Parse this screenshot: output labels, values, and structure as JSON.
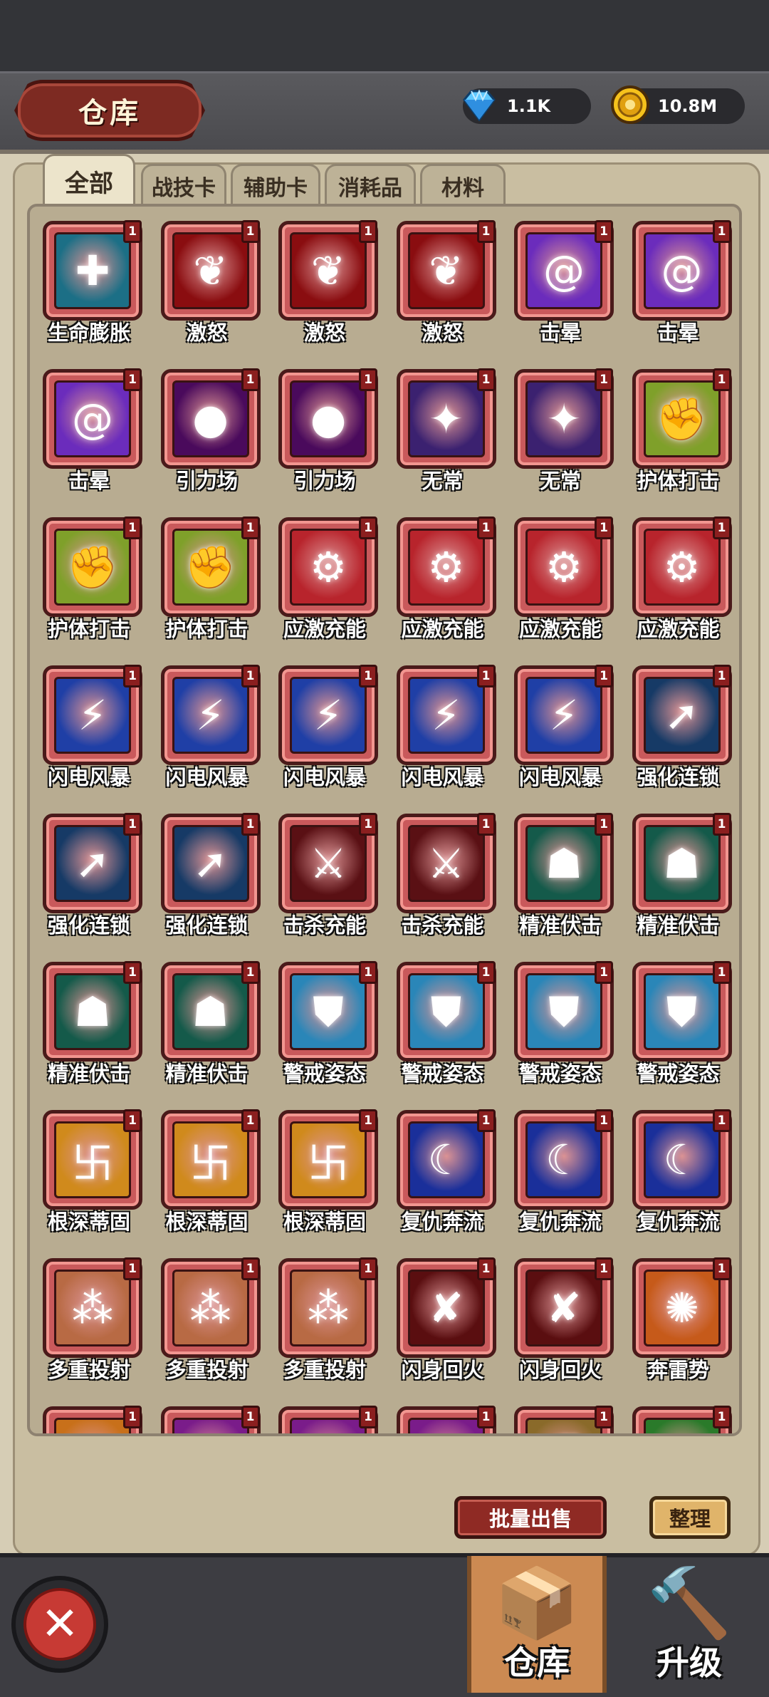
{
  "header": {
    "title": "仓库",
    "gems": "1.1K",
    "coins": "10.8M",
    "gem_icon": "diamond-icon",
    "coin_icon": "coin-icon"
  },
  "tabs": [
    {
      "label": "全部",
      "active": true
    },
    {
      "label": "战技卡"
    },
    {
      "label": "辅助卡"
    },
    {
      "label": "消耗品"
    },
    {
      "label": "材料"
    }
  ],
  "items": [
    {
      "name": "生命膨胀",
      "count": "1",
      "icon": "heal-icon",
      "color": "#1c6f86"
    },
    {
      "name": "激怒",
      "count": "1",
      "icon": "rage-icon",
      "color": "#8a0d10"
    },
    {
      "name": "激怒",
      "count": "1",
      "icon": "rage-icon",
      "color": "#8a0d10"
    },
    {
      "name": "激怒",
      "count": "1",
      "icon": "rage-icon",
      "color": "#8a0d10"
    },
    {
      "name": "击晕",
      "count": "1",
      "icon": "vortex-icon",
      "color": "#6b2cbc"
    },
    {
      "name": "击晕",
      "count": "1",
      "icon": "vortex-icon",
      "color": "#6b2cbc"
    },
    {
      "name": "击晕",
      "count": "1",
      "icon": "vortex-icon",
      "color": "#6b2cbc"
    },
    {
      "name": "引力场",
      "count": "1",
      "icon": "gravity-icon",
      "color": "#4a0a5c"
    },
    {
      "name": "引力场",
      "count": "1",
      "icon": "gravity-icon",
      "color": "#4a0a5c"
    },
    {
      "name": "无常",
      "count": "1",
      "icon": "eye-icon",
      "color": "#3b2170"
    },
    {
      "name": "无常",
      "count": "1",
      "icon": "eye-icon",
      "color": "#3b2170"
    },
    {
      "name": "护体打击",
      "count": "1",
      "icon": "fist-icon",
      "color": "#7fa02a"
    },
    {
      "name": "护体打击",
      "count": "1",
      "icon": "fist-icon",
      "color": "#7fa02a"
    },
    {
      "name": "护体打击",
      "count": "1",
      "icon": "fist-icon",
      "color": "#7fa02a"
    },
    {
      "name": "应激充能",
      "count": "1",
      "icon": "gear-icon",
      "color": "#b8242c"
    },
    {
      "name": "应激充能",
      "count": "1",
      "icon": "gear-icon",
      "color": "#b8242c"
    },
    {
      "name": "应激充能",
      "count": "1",
      "icon": "gear-icon",
      "color": "#b8242c"
    },
    {
      "name": "应激充能",
      "count": "1",
      "icon": "gear-icon",
      "color": "#b8242c"
    },
    {
      "name": "闪电风暴",
      "count": "1",
      "icon": "lightning-icon",
      "color": "#1f3fa6"
    },
    {
      "name": "闪电风暴",
      "count": "1",
      "icon": "lightning-icon",
      "color": "#1f3fa6"
    },
    {
      "name": "闪电风暴",
      "count": "1",
      "icon": "lightning-icon",
      "color": "#1f3fa6"
    },
    {
      "name": "闪电风暴",
      "count": "1",
      "icon": "lightning-icon",
      "color": "#1f3fa6"
    },
    {
      "name": "闪电风暴",
      "count": "1",
      "icon": "lightning-icon",
      "color": "#1f3fa6"
    },
    {
      "name": "强化连锁",
      "count": "1",
      "icon": "arrow-up-icon",
      "color": "#163a66"
    },
    {
      "name": "强化连锁",
      "count": "1",
      "icon": "arrow-up-icon",
      "color": "#163a66"
    },
    {
      "name": "强化连锁",
      "count": "1",
      "icon": "arrow-up-icon",
      "color": "#163a66"
    },
    {
      "name": "击杀充能",
      "count": "1",
      "icon": "blade-icon",
      "color": "#5a1014"
    },
    {
      "name": "击杀充能",
      "count": "1",
      "icon": "blade-icon",
      "color": "#5a1014"
    },
    {
      "name": "精准伏击",
      "count": "1",
      "icon": "shadow-icon",
      "color": "#145a4a"
    },
    {
      "name": "精准伏击",
      "count": "1",
      "icon": "shadow-icon",
      "color": "#145a4a"
    },
    {
      "name": "精准伏击",
      "count": "1",
      "icon": "shadow-icon",
      "color": "#145a4a"
    },
    {
      "name": "精准伏击",
      "count": "1",
      "icon": "shadow-icon",
      "color": "#145a4a"
    },
    {
      "name": "警戒姿态",
      "count": "1",
      "icon": "shield-icon",
      "color": "#2a86b8"
    },
    {
      "name": "警戒姿态",
      "count": "1",
      "icon": "shield-icon",
      "color": "#2a86b8"
    },
    {
      "name": "警戒姿态",
      "count": "1",
      "icon": "shield-icon",
      "color": "#2a86b8"
    },
    {
      "name": "警戒姿态",
      "count": "1",
      "icon": "shield-icon",
      "color": "#2a86b8"
    },
    {
      "name": "根深蒂固",
      "count": "1",
      "icon": "root-icon",
      "color": "#d08a1c"
    },
    {
      "name": "根深蒂固",
      "count": "1",
      "icon": "root-icon",
      "color": "#d08a1c"
    },
    {
      "name": "根深蒂固",
      "count": "1",
      "icon": "root-icon",
      "color": "#d08a1c"
    },
    {
      "name": "复仇奔流",
      "count": "1",
      "icon": "wave-icon",
      "color": "#1a2f9a"
    },
    {
      "name": "复仇奔流",
      "count": "1",
      "icon": "wave-icon",
      "color": "#1a2f9a"
    },
    {
      "name": "复仇奔流",
      "count": "1",
      "icon": "wave-icon",
      "color": "#1a2f9a"
    },
    {
      "name": "多重投射",
      "count": "1",
      "icon": "multishot-icon",
      "color": "#b86a44"
    },
    {
      "name": "多重投射",
      "count": "1",
      "icon": "multishot-icon",
      "color": "#b86a44"
    },
    {
      "name": "多重投射",
      "count": "1",
      "icon": "multishot-icon",
      "color": "#b86a44"
    },
    {
      "name": "闪身回火",
      "count": "1",
      "icon": "dash-icon",
      "color": "#5a0e10"
    },
    {
      "name": "闪身回火",
      "count": "1",
      "icon": "dash-icon",
      "color": "#5a0e10"
    },
    {
      "name": "奔雷势",
      "count": "1",
      "icon": "burst-icon",
      "color": "#c65a1a"
    },
    {
      "name": "",
      "count": "1",
      "icon": "burst-icon",
      "color": "#c8701a"
    },
    {
      "name": "",
      "count": "1",
      "icon": "magic-icon",
      "color": "#7a1c8a"
    },
    {
      "name": "",
      "count": "1",
      "icon": "magic-icon",
      "color": "#7a1c8a"
    },
    {
      "name": "",
      "count": "1",
      "icon": "magic-icon",
      "color": "#7a1c8a"
    },
    {
      "name": "",
      "count": "1",
      "icon": "fist-gold-icon",
      "color": "#8a6a2a"
    },
    {
      "name": "",
      "count": "1",
      "icon": "leaf-icon",
      "color": "#2a7a2a"
    }
  ],
  "actions": {
    "bulk_sell": "批量出售",
    "sort": "整理"
  },
  "nav": {
    "close_icon": "close-icon",
    "warehouse": "仓库",
    "upgrade": "升级"
  }
}
